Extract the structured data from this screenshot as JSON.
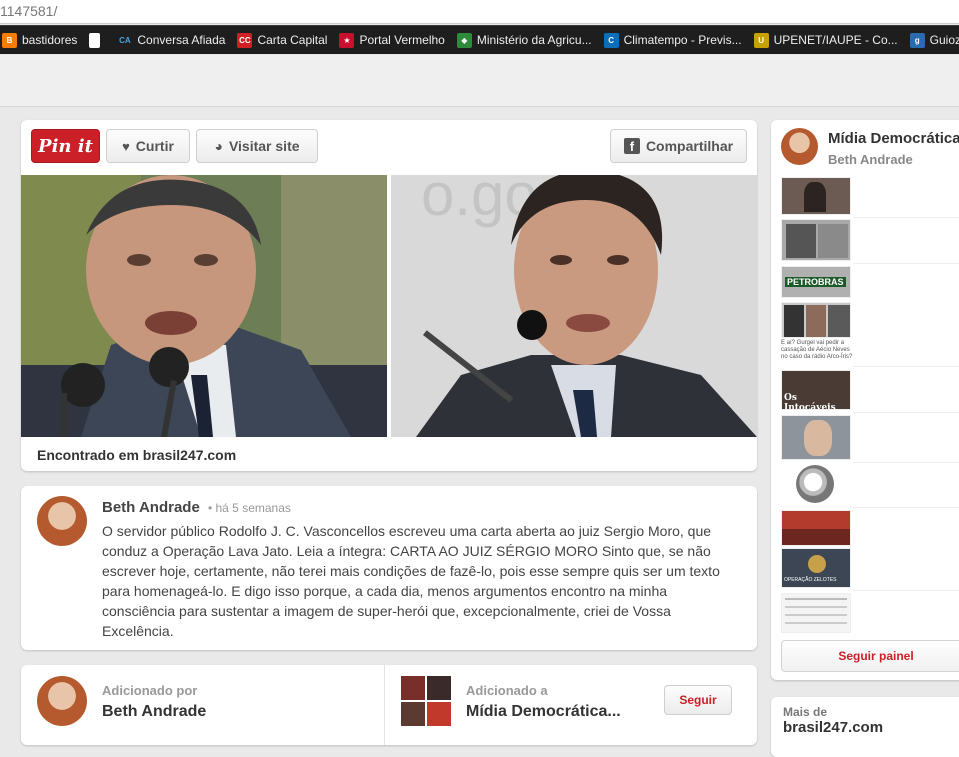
{
  "browser": {
    "url_fragment": "1147581/",
    "bookmarks": [
      {
        "label": "bastidores",
        "icon": "blogger-icon",
        "color": "#f57d00",
        "glyph": "B"
      },
      {
        "label": "",
        "icon": "page-icon",
        "color": "#ffffff",
        "glyph": ""
      },
      {
        "label": "Conversa Afiada",
        "icon": "ca-icon",
        "color": "#1e1e1e",
        "glyph": "CA"
      },
      {
        "label": "Carta Capital",
        "icon": "cc-icon",
        "color": "#d21f26",
        "glyph": "CC"
      },
      {
        "label": "Portal Vermelho",
        "icon": "star-icon",
        "color": "#c8102e",
        "glyph": "★"
      },
      {
        "label": "Ministério da Agricu...",
        "icon": "brasil-flag-icon",
        "color": "#2e8b3a",
        "glyph": "◆"
      },
      {
        "label": "Climatempo - Previs...",
        "icon": "climatempo-icon",
        "color": "#0a6fb8",
        "glyph": "C"
      },
      {
        "label": "UPENET/IAUPE - Co...",
        "icon": "upe-icon",
        "color": "#c8a000",
        "glyph": "U"
      },
      {
        "label": "Guioz",
        "icon": "guioz-icon",
        "color": "#2a6bb0",
        "glyph": "g"
      }
    ]
  },
  "pin": {
    "pinit_label": "Pin it",
    "like_label": "Curtir",
    "visit_label": "Visitar site",
    "share_label": "Compartilhar",
    "found_prefix": "Encontrado em",
    "found_domain": "brasil247.com"
  },
  "description": {
    "author": "Beth Andrade",
    "time": "• há 5 semanas",
    "text": "O servidor público Rodolfo J. C. Vasconcellos escreveu uma carta aberta ao juiz Sergio Moro, que conduz a Operação Lava Jato. Leia a íntegra: CARTA AO JUIZ SÉRGIO MORO Sinto que, se não escrever hoje, certamente, não terei mais condições de fazê-lo, pois esse sempre quis ser um texto para homenageá-lo. E digo isso porque, a cada dia, menos argumentos encontro na minha consciência para sustentar a imagem de super-herói que, excepcionalmente, criei de Vossa Excelência."
  },
  "added": {
    "by_label": "Adicionado por",
    "by_name": "Beth Andrade",
    "to_label": "Adicionado a",
    "to_board": "Mídia Democrática...",
    "follow_label": "Seguir"
  },
  "board": {
    "title": "Mídia Democrática",
    "owner": "Beth Andrade",
    "follow_label": "Seguir painel",
    "thumb_caption": "E aí? Gurgel vai pedir a cassação de Aécio Neves no caso da rádio Arco-Íris?",
    "petrobras_text": "PETROBRAS",
    "intocaveis_text": "Os Intocáveis",
    "operacao_text": "OPERAÇÃO ZELOTES"
  },
  "more": {
    "label": "Mais de",
    "domain": "brasil247.com"
  }
}
